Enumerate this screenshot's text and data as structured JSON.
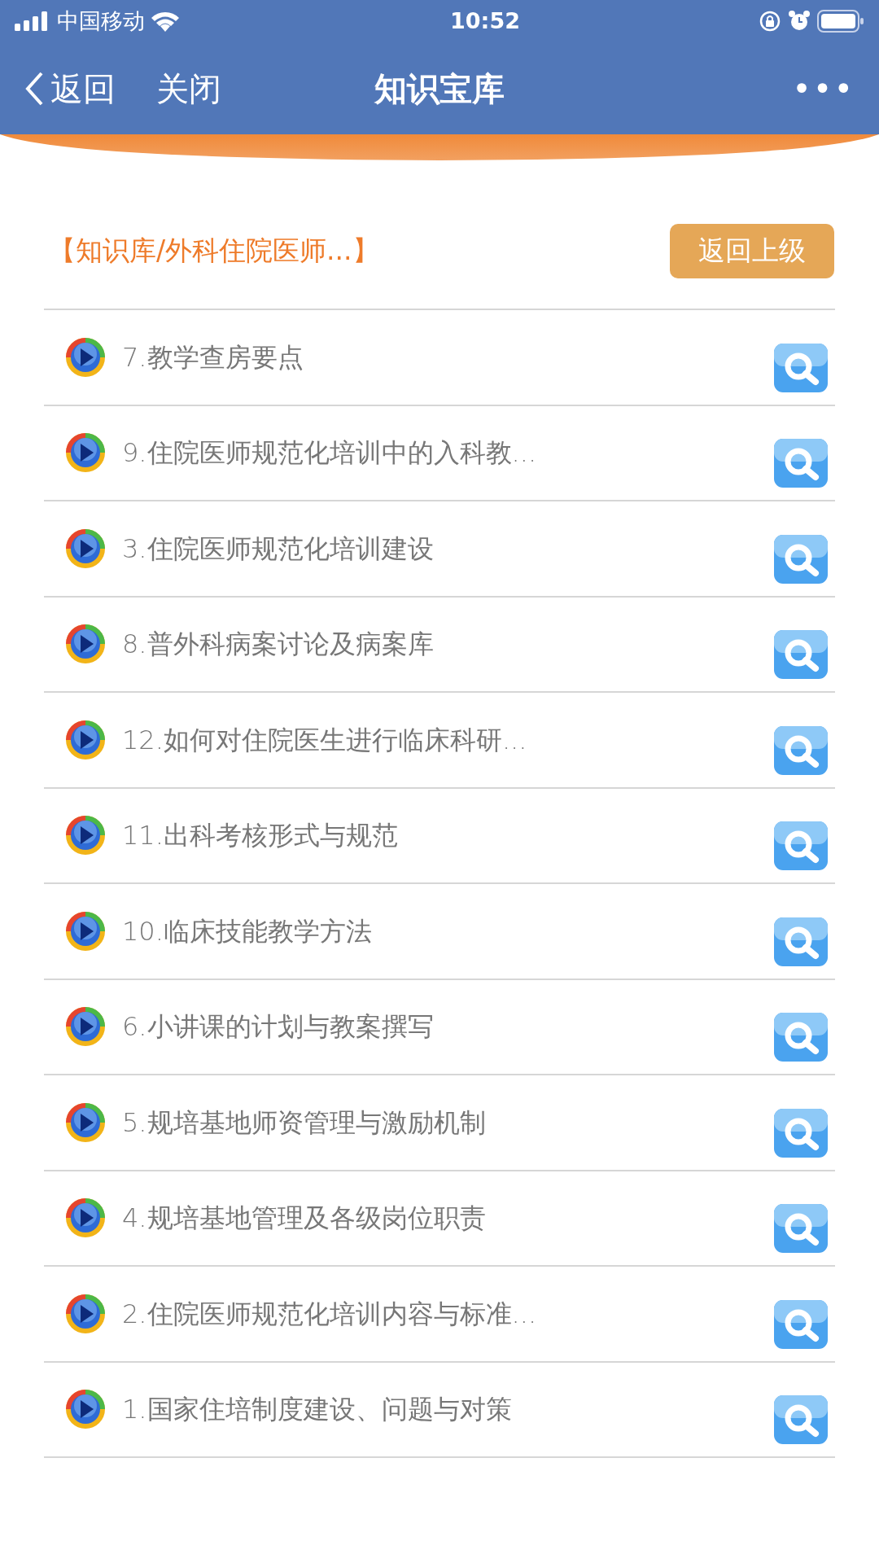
{
  "status_bar": {
    "carrier": "中国移动",
    "time": "10:52"
  },
  "nav_bar": {
    "back": "返回",
    "close": "关闭",
    "title": "知识宝库",
    "more": "•••"
  },
  "breadcrumb": "【知识库/外科住院医师...】",
  "up_button": "返回上级",
  "items": [
    {
      "title": "7.教学查房要点"
    },
    {
      "title": "9.住院医师规范化培训中的入科教..."
    },
    {
      "title": "3.住院医师规范化培训建设"
    },
    {
      "title": "8.普外科病案讨论及病案库"
    },
    {
      "title": "12.如何对住院医生进行临床科研..."
    },
    {
      "title": "11.出科考核形式与规范"
    },
    {
      "title": "10.临床技能教学方法"
    },
    {
      "title": "6.小讲课的计划与教案撰写"
    },
    {
      "title": "5.规培基地师资管理与激励机制"
    },
    {
      "title": "4.规培基地管理及各级岗位职责"
    },
    {
      "title": "2.住院医师规范化培训内容与标准..."
    },
    {
      "title": "1.国家住培制度建设、问题与对策"
    }
  ]
}
